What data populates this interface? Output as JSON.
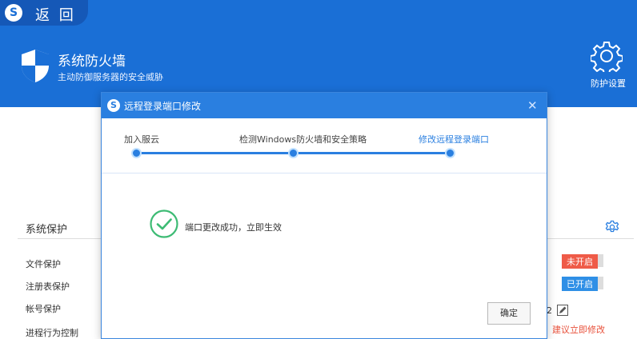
{
  "header": {
    "back_label": "返 回",
    "title": "系统防火墙",
    "subtitle": "主动防御服务器的安全威胁",
    "settings_label": "防护设置"
  },
  "background_panel": {
    "section_title": "系统保护",
    "items": [
      "文件保护",
      "注册表保护",
      "帐号保护",
      "进程行为控制"
    ],
    "status_off": "未开启",
    "status_on": "已开启",
    "account_suffix": "2",
    "suggest_text": "建议立即修改"
  },
  "dialog": {
    "title": "远程登录端口修改",
    "steps": [
      {
        "label": "加入服云",
        "active": false
      },
      {
        "label": "检测Windows防火墙和安全策略",
        "active": false
      },
      {
        "label": "修改远程登录端口",
        "active": true
      }
    ],
    "message": "端口更改成功，立即生效",
    "confirm_label": "确定",
    "close_glyph": "✕"
  },
  "colors": {
    "header_blue": "#1a6fd6",
    "accent_blue": "#2a7fe0",
    "success_green": "#3dbb74",
    "off_red": "#ef5b48",
    "on_blue": "#2f8fe6",
    "suggest_red": "#e8503a"
  },
  "icons": {
    "logo": "s-logo-icon",
    "shield": "shield-icon",
    "settings": "gear-icon",
    "close": "close-icon",
    "success": "check-circle-icon",
    "edit": "pencil-icon"
  }
}
